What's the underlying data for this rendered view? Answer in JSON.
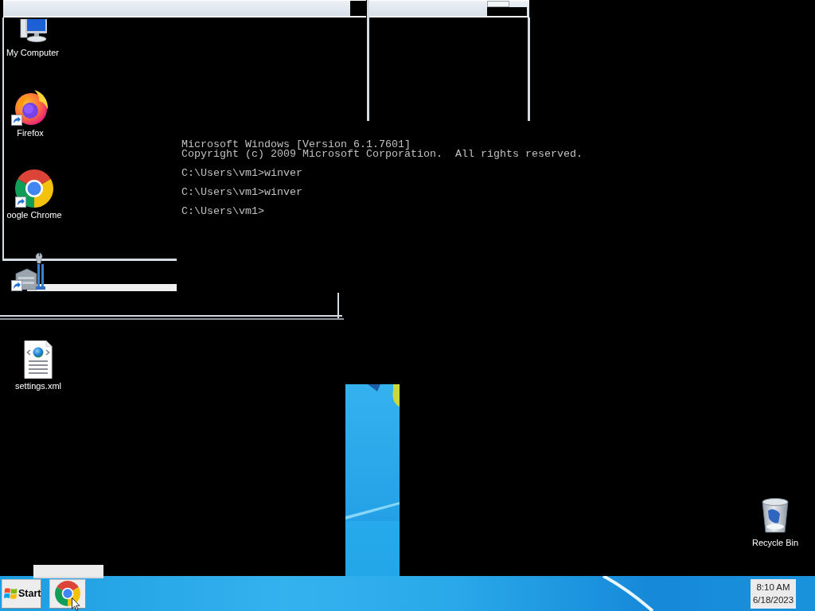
{
  "console": {
    "paragraphs": [
      [
        "Microsoft Windows [Version 6.1.7601]",
        "Copyright (c) 2009 Microsoft Corporation.  All rights reserved."
      ],
      [
        "C:\\Users\\vm1>winver"
      ],
      [
        "C:\\Users\\vm1>winver"
      ],
      [
        "C:\\Users\\vm1>"
      ]
    ]
  },
  "desktop_icons": [
    {
      "kind": "computer",
      "label": "My Computer",
      "shortcut": false
    },
    {
      "kind": "firefox",
      "label": "Firefox",
      "shortcut": true
    },
    {
      "kind": "chrome",
      "label": "oogle Chrome",
      "shortcut": true
    },
    {
      "kind": "tools",
      "shortcut": true
    },
    {
      "kind": "xml",
      "label": "settings.xml",
      "shortcut": false
    },
    {
      "kind": "recycle_bin",
      "label": "Recycle Bin",
      "shortcut": false
    }
  ],
  "taskbar": {
    "start_label": "Start",
    "buttons": [
      {
        "kind": "chrome"
      }
    ],
    "clock": {
      "time": "8:10 AM",
      "date": "6/18/2023"
    }
  }
}
